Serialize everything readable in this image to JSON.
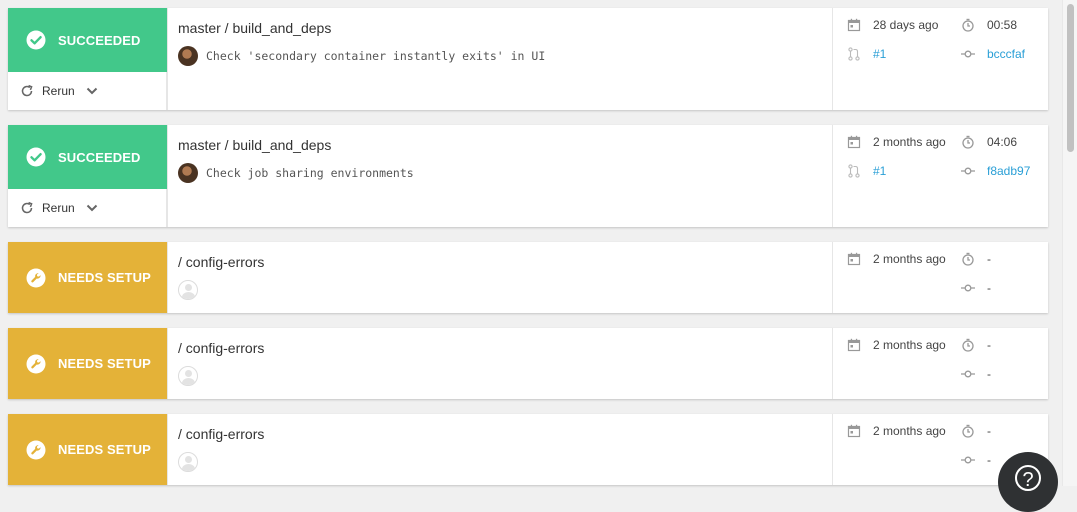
{
  "builds": [
    {
      "status": "SUCCEEDED",
      "status_type": "success",
      "title": "master / build_and_deps",
      "commit_message": "Check 'secondary container instantly exits' in UI",
      "rerun_label": "Rerun",
      "time_ago": "28 days ago",
      "duration": "00:58",
      "pr": "#1",
      "commit": "bcccfaf"
    },
    {
      "status": "SUCCEEDED",
      "status_type": "success",
      "title": "master / build_and_deps",
      "commit_message": "Check job sharing environments",
      "rerun_label": "Rerun",
      "time_ago": "2 months ago",
      "duration": "04:06",
      "pr": "#1",
      "commit": "f8adb97"
    },
    {
      "status": "NEEDS SETUP",
      "status_type": "setup",
      "title": "/ config-errors",
      "time_ago": "2 months ago",
      "duration": "-",
      "commit": "-"
    },
    {
      "status": "NEEDS SETUP",
      "status_type": "setup",
      "title": "/ config-errors",
      "time_ago": "2 months ago",
      "duration": "-",
      "commit": "-"
    },
    {
      "status": "NEEDS SETUP",
      "status_type": "setup",
      "title": "/ config-errors",
      "time_ago": "2 months ago",
      "duration": "-",
      "commit": "-"
    }
  ],
  "help": {
    "label": "?"
  },
  "colors": {
    "success": "#42c88a",
    "setup": "#e4b238",
    "link": "#2a9fd6"
  },
  "icons": [
    "check-circle-icon",
    "wrench-icon",
    "rerun-icon",
    "chevron-down-icon",
    "calendar-icon",
    "stopwatch-icon",
    "pull-request-icon",
    "commit-icon"
  ]
}
